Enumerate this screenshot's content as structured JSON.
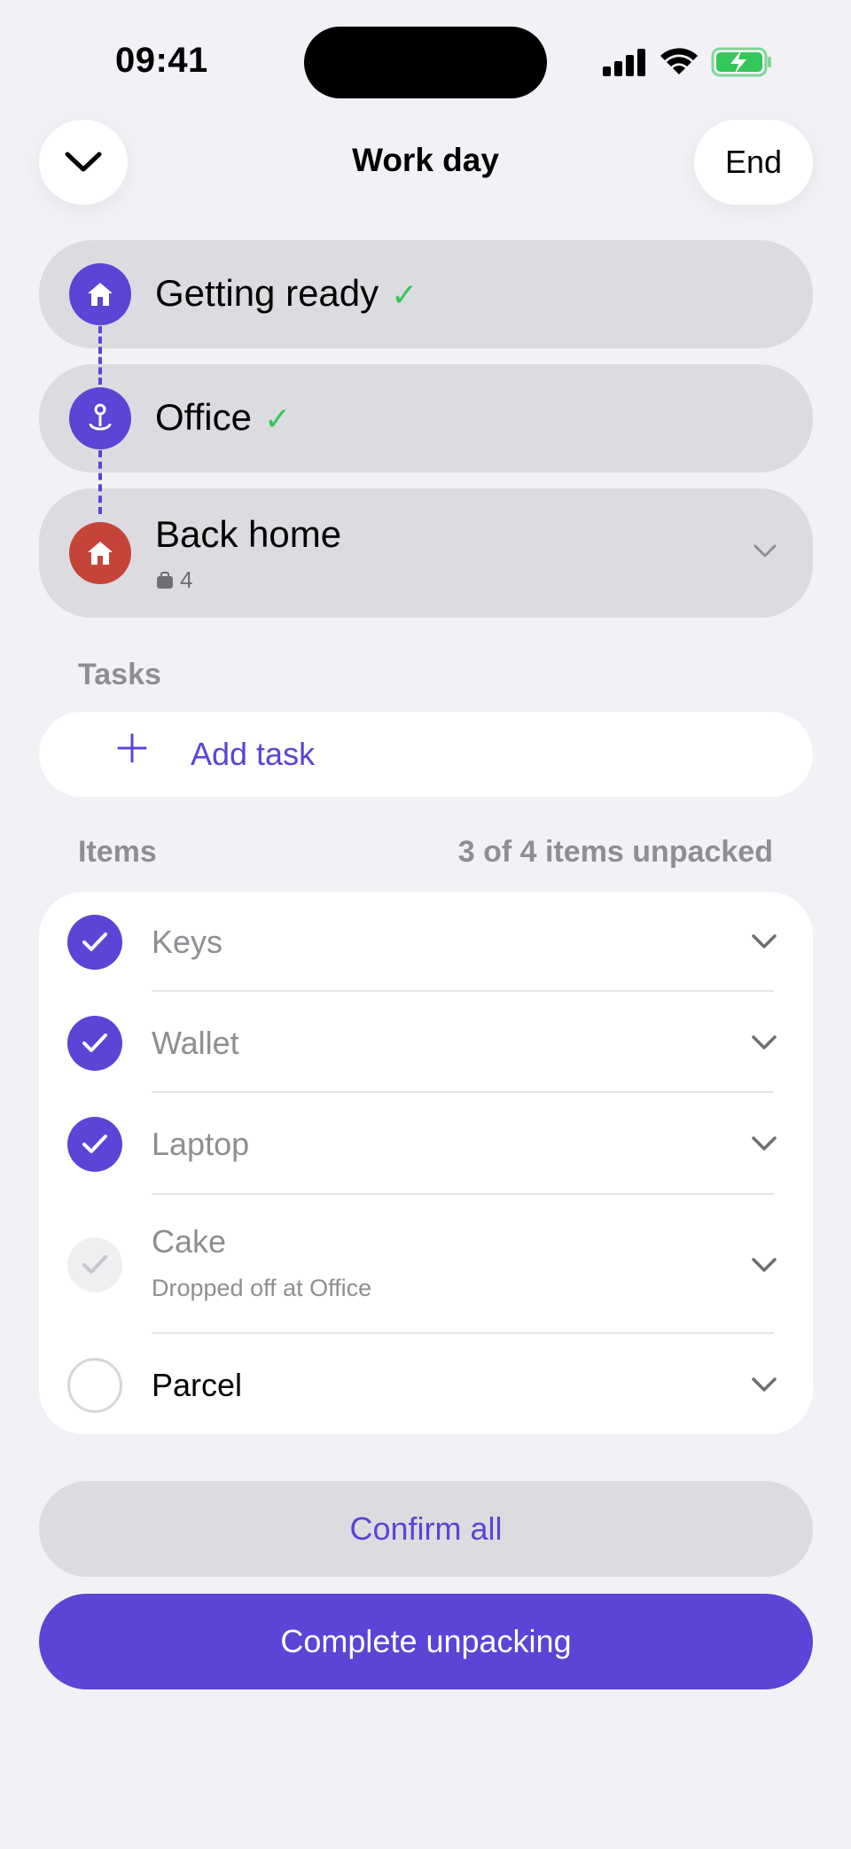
{
  "status_bar": {
    "time": "09:41"
  },
  "header": {
    "title": "Work day",
    "end_label": "End"
  },
  "stops": [
    {
      "name": "Getting ready",
      "done": true,
      "icon": "house-icon",
      "color": "#5B44D6"
    },
    {
      "name": "Office",
      "done": true,
      "icon": "location-pin-icon",
      "color": "#5B44D6"
    },
    {
      "name": "Back home",
      "done": false,
      "icon": "house-icon",
      "color": "#C5443A",
      "item_count": "4"
    }
  ],
  "tasks": {
    "label": "Tasks",
    "add_label": "Add task"
  },
  "items": {
    "label": "Items",
    "summary": "3 of 4 items unpacked",
    "list": [
      {
        "name": "Keys",
        "state": "checked"
      },
      {
        "name": "Wallet",
        "state": "checked"
      },
      {
        "name": "Laptop",
        "state": "checked"
      },
      {
        "name": "Cake",
        "state": "dropped",
        "note": "Dropped off at Office"
      },
      {
        "name": "Parcel",
        "state": "unchecked"
      }
    ]
  },
  "actions": {
    "confirm_label": "Confirm all",
    "complete_label": "Complete unpacking"
  },
  "colors": {
    "accent": "#5B44D6",
    "home_red": "#C5443A",
    "check_green": "#34C759",
    "battery_green": "#34C759"
  }
}
